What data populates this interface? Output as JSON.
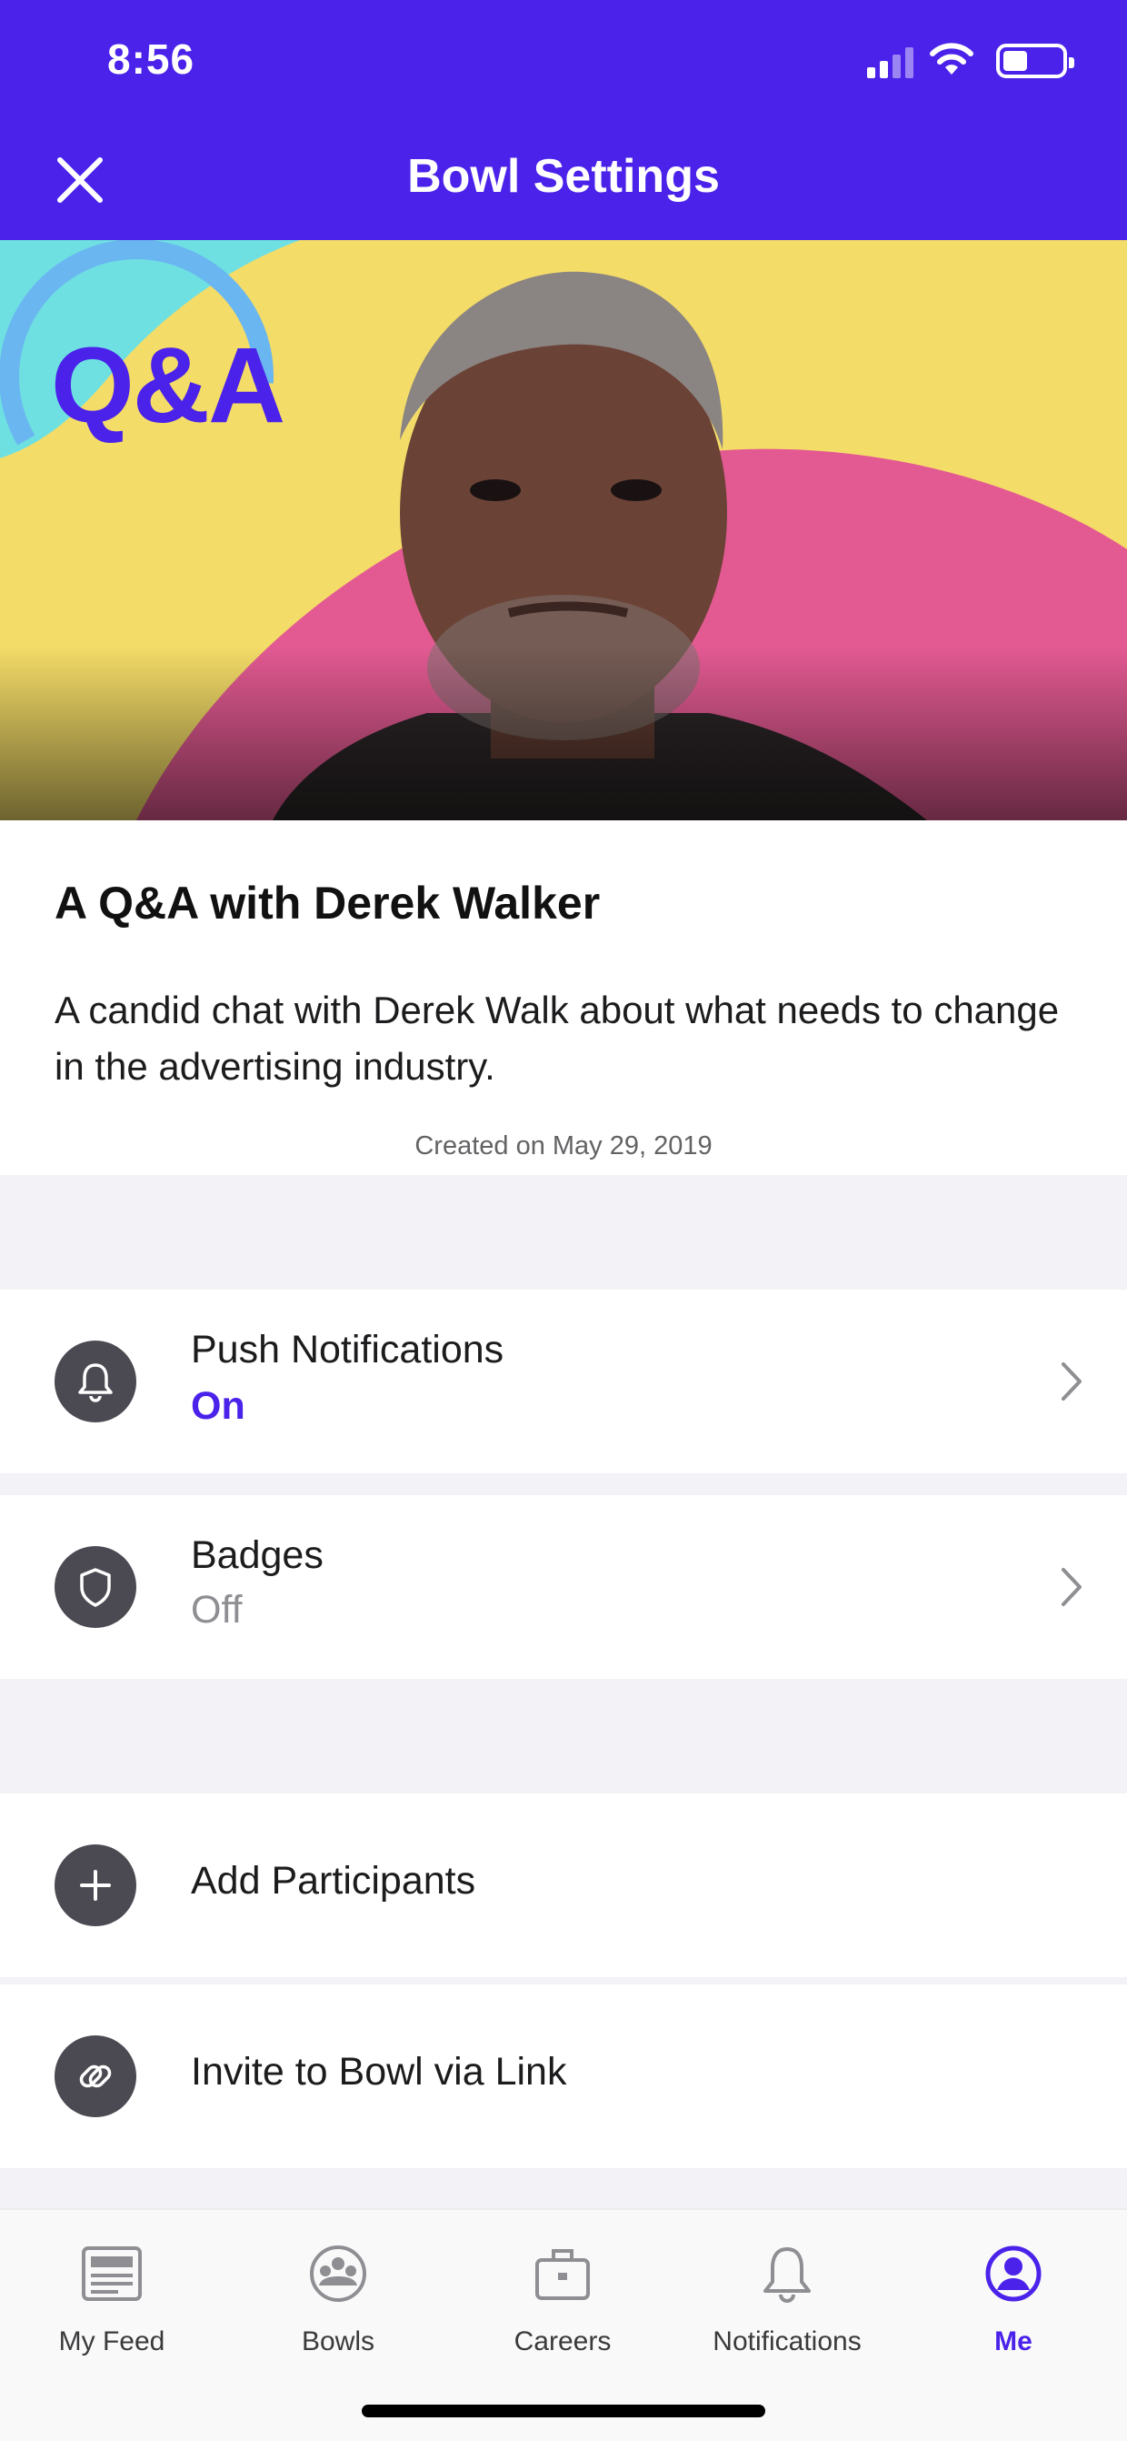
{
  "status": {
    "time": "8:56"
  },
  "header": {
    "title": "Bowl Settings",
    "close_icon": "close-icon"
  },
  "hero": {
    "badge_text": "Q&A"
  },
  "bowl": {
    "title": "A Q&A with Derek Walker",
    "description": "A candid chat with Derek Walk about what needs to change in the advertising industry.",
    "created": "Created on May 29, 2019"
  },
  "settings": [
    {
      "label": "Push Notifications",
      "value": "On",
      "icon": "bell-icon"
    },
    {
      "label": "Badges",
      "value": "Off",
      "icon": "shield-icon"
    }
  ],
  "actions": [
    {
      "label": "Add Participants",
      "icon": "plus-icon"
    },
    {
      "label": "Invite to Bowl via Link",
      "icon": "link-icon"
    }
  ],
  "tabs": [
    {
      "label": "My Feed",
      "icon": "feed-icon"
    },
    {
      "label": "Bowls",
      "icon": "bowls-icon"
    },
    {
      "label": "Careers",
      "icon": "briefcase-icon"
    },
    {
      "label": "Notifications",
      "icon": "bell-icon"
    },
    {
      "label": "Me",
      "icon": "profile-icon",
      "active": true
    }
  ],
  "colors": {
    "accent": "#4a22ea",
    "on": "#4a22ea",
    "off": "#8e8e93",
    "icon_bg": "#4b4a52"
  }
}
